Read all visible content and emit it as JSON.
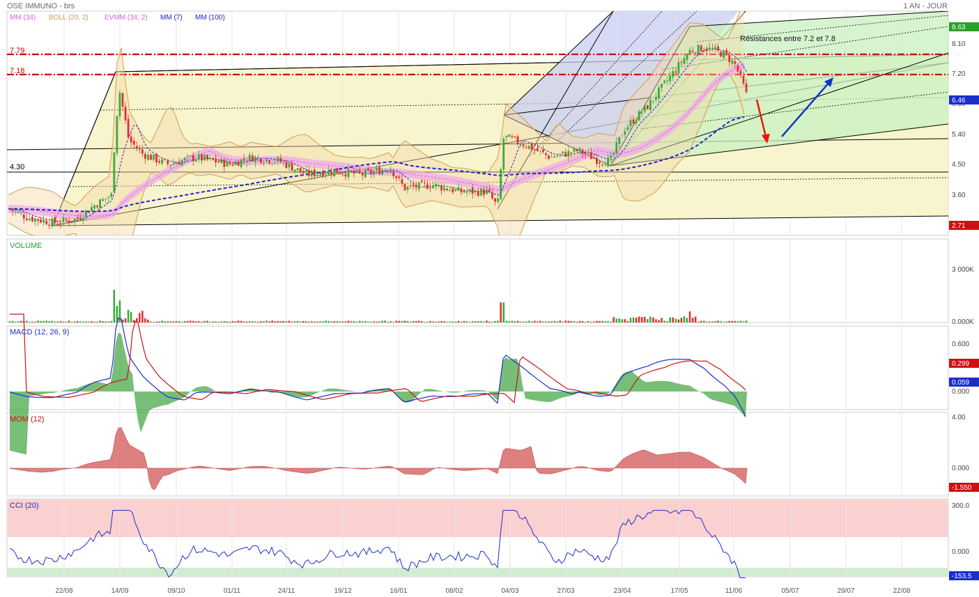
{
  "header": {
    "symbol": "OSE IMMUNO - brs",
    "period": "1 AN - JOUR"
  },
  "legend": [
    {
      "label": "MM (34)",
      "color": "#e060e0"
    },
    {
      "label": "BOLL (20, 2)",
      "color": "#d49a50"
    },
    {
      "label": "EVMM (34, 2)",
      "color": "#e060e0"
    },
    {
      "label": "MM (7)",
      "color": "#2222cc"
    },
    {
      "label": "MM (100)",
      "color": "#2222cc"
    }
  ],
  "annotations": {
    "resistance_text": "Résistances entre 7.2 et 7.8",
    "level_779": "7.79",
    "level_718": "7.18",
    "level_430": "4.30"
  },
  "x_ticks": [
    "22/08",
    "14/09",
    "09/10",
    "01/11",
    "24/11",
    "19/12",
    "16/01",
    "08/02",
    "04/03",
    "27/03",
    "23/04",
    "17/05",
    "11/06",
    "05/07",
    "29/07",
    "22/08"
  ],
  "price_panel": {
    "ticks": [
      "8.10",
      "7.20",
      "6.30",
      "5.40",
      "4.50",
      "3.60"
    ],
    "high_badge": "8.63",
    "last_badge": "6.46",
    "low_badge": "2.71"
  },
  "volume_panel": {
    "title": "VOLUME",
    "ticks": [
      "3 000K",
      "0.000K"
    ]
  },
  "macd_panel": {
    "title": "MACD (12, 26, 9)",
    "ticks": [
      "0.600",
      "0.000"
    ],
    "badge_signal": "0.299",
    "badge_macd": "0.059"
  },
  "mom_panel": {
    "title": "MOM (12)",
    "ticks": [
      "4.00",
      "0.000"
    ],
    "badge": "-1.550"
  },
  "cci_panel": {
    "title": "CCI (20)",
    "ticks": [
      "300.0",
      "0.000"
    ],
    "badge": "-153.5"
  },
  "colors": {
    "up": "#3aaa3a",
    "down": "#e03030",
    "resistance": "#cc0000",
    "ma_blue": "#2222cc",
    "boll": "#d49a50",
    "channel_yellow": "#f5f2c8",
    "channel_blue": "#c9cdf0",
    "channel_green": "#c8f0c0",
    "arrow_red": "#ee1111",
    "arrow_blue": "#1133cc"
  },
  "chart_data": {
    "type": "candlestick",
    "title": "OSE IMMUNO - brs",
    "period": "1 AN - JOUR",
    "y_range": [
      2.71,
      8.63
    ],
    "last_close": 6.46,
    "resistance_levels": [
      7.79,
      7.18
    ],
    "support_level": 4.3,
    "approx_close_path": [
      {
        "date": "22/08",
        "close": 2.9
      },
      {
        "date": "14/09",
        "close": 6.8
      },
      {
        "date": "09/10",
        "close": 4.7
      },
      {
        "date": "01/11",
        "close": 4.5
      },
      {
        "date": "24/11",
        "close": 4.6
      },
      {
        "date": "19/12",
        "close": 4.3
      },
      {
        "date": "16/01",
        "close": 4.4
      },
      {
        "date": "08/02",
        "close": 3.7
      },
      {
        "date": "04/03",
        "close": 5.2
      },
      {
        "date": "27/03",
        "close": 4.9
      },
      {
        "date": "23/04",
        "close": 4.8
      },
      {
        "date": "17/05",
        "close": 7.9
      },
      {
        "date": "11/06",
        "close": 6.46
      }
    ],
    "indicators": {
      "macd_last": 0.059,
      "macd_signal_last": 0.299,
      "mom_last": -1.55,
      "cci_last": -153.5
    }
  }
}
